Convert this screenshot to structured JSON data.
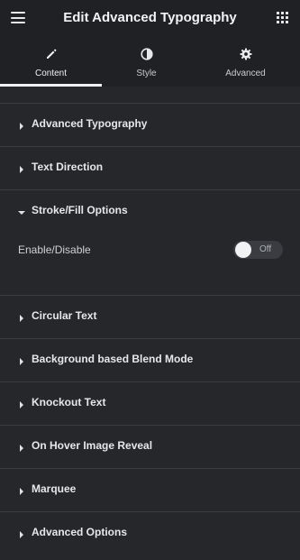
{
  "header": {
    "title": "Edit Advanced Typography",
    "menu_icon": "hamburger-icon",
    "apps_icon": "grid-icon"
  },
  "tabs": [
    {
      "label": "Content",
      "icon": "pencil-icon",
      "active": true
    },
    {
      "label": "Style",
      "icon": "half-circle-icon",
      "active": false
    },
    {
      "label": "Advanced",
      "icon": "gear-icon",
      "active": false
    }
  ],
  "sections": [
    {
      "label": "Advanced Typography",
      "open": false
    },
    {
      "label": "Text Direction",
      "open": false
    },
    {
      "label": "Stroke/Fill Options",
      "open": true
    },
    {
      "label": "Circular Text",
      "open": false
    },
    {
      "label": "Background based Blend Mode",
      "open": false
    },
    {
      "label": "Knockout Text",
      "open": false
    },
    {
      "label": "On Hover Image Reveal",
      "open": false
    },
    {
      "label": "Marquee",
      "open": false
    },
    {
      "label": "Advanced Options",
      "open": false
    }
  ],
  "stroke_fill": {
    "enable_label": "Enable/Disable",
    "toggle_state": "Off"
  },
  "colors": {
    "panel_bg": "#26272b",
    "header_bg": "#1f2124",
    "divider": "#3b3d42",
    "text": "#e0e1e3"
  }
}
